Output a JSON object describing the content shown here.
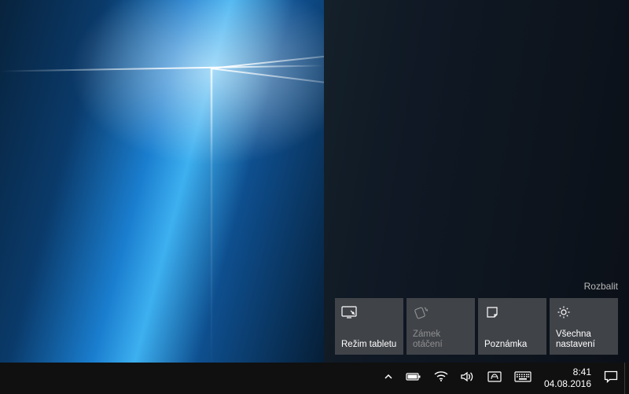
{
  "action_center": {
    "expand_label": "Rozbalit",
    "tiles": {
      "tablet": {
        "label": "Režim tabletu",
        "icon": "tablet-mode"
      },
      "rotation": {
        "label": "Zámek otáčení",
        "icon": "rotation-lock",
        "disabled": true
      },
      "note": {
        "label": "Poznámka",
        "icon": "note"
      },
      "settings": {
        "label": "Všechna nastavení",
        "icon": "gear"
      }
    }
  },
  "taskbar": {
    "clock": {
      "time": "8:41",
      "date": "04.08.2016"
    },
    "tray_icons": [
      "overflow-chevron",
      "battery",
      "wifi",
      "volume",
      "language",
      "touch-keyboard"
    ]
  }
}
